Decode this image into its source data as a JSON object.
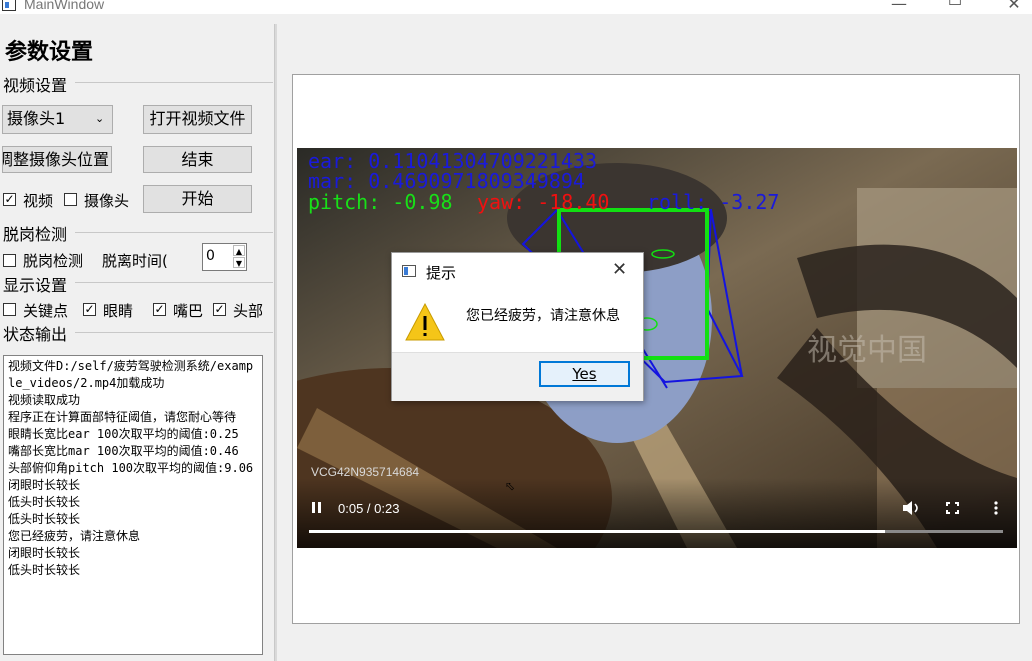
{
  "window": {
    "title": "MainWindow"
  },
  "left": {
    "heading": "参数设置",
    "video_section": "视频设置",
    "camera_select": "摄像头1",
    "open_video_btn": "打开视频文件",
    "adjust_camera_btn": "调整摄像头位置",
    "end_btn": "结束",
    "video_cb": {
      "label": "视频",
      "checked": true
    },
    "camera_cb": {
      "label": "摄像头",
      "checked": false
    },
    "start_btn": "开始",
    "absence_section": "脱岗检测",
    "absence_cb": {
      "label": "脱岗检测",
      "checked": false
    },
    "absence_time_label": "脱离时间(",
    "absence_time_value": "0",
    "display_section": "显示设置",
    "keypoints_cb": {
      "label": "关键点",
      "checked": false
    },
    "eyes_cb": {
      "label": "眼睛",
      "checked": true
    },
    "mouth_cb": {
      "label": "嘴巴",
      "checked": true
    },
    "head_cb": {
      "label": "头部",
      "checked": true
    },
    "status_section": "状态输出",
    "log_lines": [
      "视频文件D:/self/疲劳驾驶检测系统/example_videos/2.mp4加载成功",
      "视频读取成功",
      "程序正在计算面部特征阈值，请您耐心等待",
      "眼睛长宽比ear 100次取平均的阈值:0.25",
      "嘴部长宽比mar 100次取平均的阈值:0.46",
      "头部俯仰角pitch 100次取平均的阈值:9.06",
      "闭眼时长较长",
      "低头时长较长",
      "低头时长较长",
      "您已经疲劳，请注意休息",
      "闭眼时长较长",
      "低头时长较长"
    ]
  },
  "video": {
    "ear_text": "ear: 0.11041304709221433",
    "mar_text": "mar: 0.4690971809349894",
    "pitch_text": "pitch: -0.98",
    "yaw_text": "yaw: -18.40",
    "roll_text": "roll: -3.27",
    "watermark": "VCG42N935714684",
    "time": "0:05 / 0:23",
    "progress": 0.83
  },
  "dialog": {
    "title": "提示",
    "message": "您已经疲劳，请注意休息",
    "yes_label": "Yes"
  },
  "colors": {
    "ear": "#1a1adb",
    "pitch": "#18e018",
    "yaw": "#f01010",
    "box_green": "#12e012",
    "box_blue": "#1414e0"
  }
}
